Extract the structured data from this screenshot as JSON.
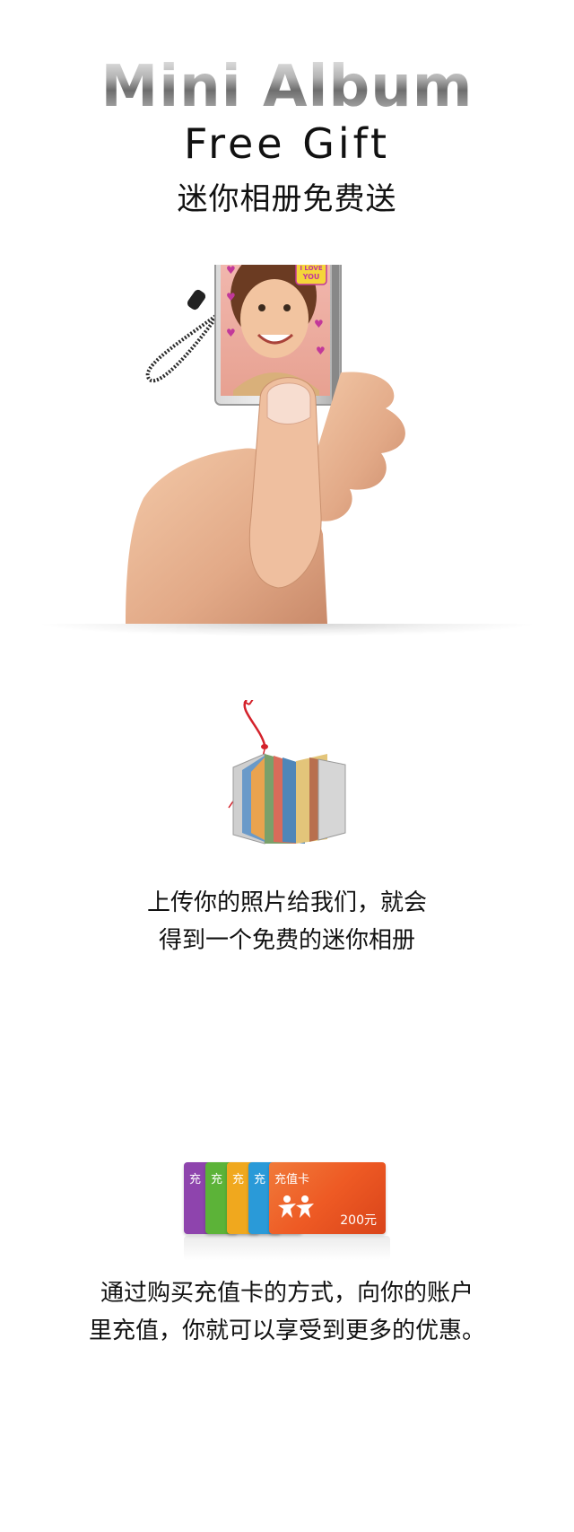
{
  "header": {
    "title_en": "Mini Album",
    "subtitle_en": "Free Gift",
    "title_cn": "迷你相册免费送"
  },
  "hero": {
    "photo_badge_line1": "I LOVE",
    "photo_badge_line2": "YOU"
  },
  "section_upload": {
    "line1": "上传你的照片给我们，就会",
    "line2": "得到一个免费的迷你相册"
  },
  "section_recharge": {
    "card_label": "充值卡",
    "stub_labels": [
      "充",
      "充",
      "充",
      "充"
    ],
    "card_amount": "200元",
    "line1": "通过购买充值卡的方式，向你的账户",
    "line2": "里充值，你就可以享受到更多的优惠。"
  },
  "colors": {
    "card_purple": "#8e44ad",
    "card_green": "#5cb338",
    "card_yellow": "#f0a81e",
    "card_blue": "#2a9ad8",
    "card_orange": "#ee5a24"
  }
}
